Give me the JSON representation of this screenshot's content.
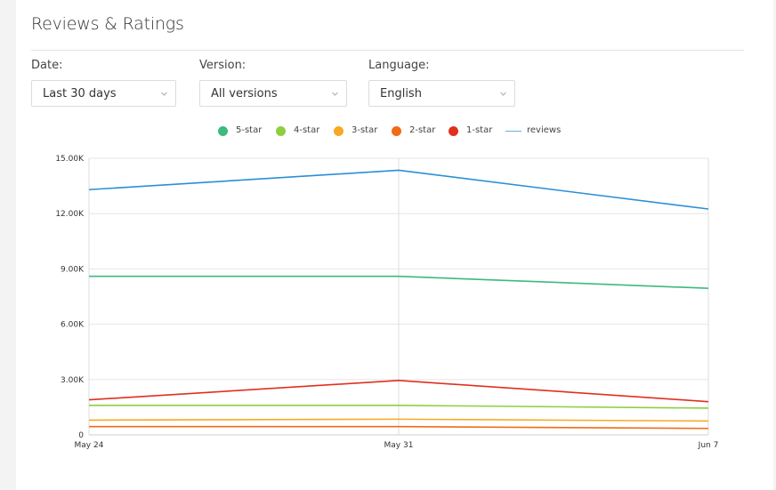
{
  "header": {
    "title": "Reviews & Ratings"
  },
  "filters": [
    {
      "label": "Date:",
      "value": "Last 30 days"
    },
    {
      "label": "Version:",
      "value": "All versions"
    },
    {
      "label": "Language:",
      "value": "English"
    }
  ],
  "legend": [
    {
      "name": "5-star",
      "color": "#3cba7f",
      "marker": "dot"
    },
    {
      "name": "4-star",
      "color": "#8ccf3f",
      "marker": "dot"
    },
    {
      "name": "3-star",
      "color": "#f9a823",
      "marker": "dot"
    },
    {
      "name": "2-star",
      "color": "#f26b17",
      "marker": "dot"
    },
    {
      "name": "1-star",
      "color": "#e0301e",
      "marker": "dot"
    },
    {
      "name": "reviews",
      "color": "#59b5e0",
      "marker": "line"
    }
  ],
  "chart_data": {
    "type": "line",
    "categories": [
      "May 24",
      "May 31",
      "Jun 7"
    ],
    "ylim": [
      0,
      15000
    ],
    "yticks": [
      0,
      3000,
      6000,
      9000,
      12000,
      15000
    ],
    "ytick_labels": [
      "0",
      "3.00K",
      "6.00K",
      "9.00K",
      "12.00K",
      "15.00K"
    ],
    "grid": true,
    "legend_position": "top-center",
    "series": [
      {
        "name": "reviews",
        "color": "#2a8fd6",
        "values": [
          13300,
          14350,
          12250
        ]
      },
      {
        "name": "5-star",
        "color": "#3cba7f",
        "values": [
          8600,
          8600,
          7950
        ]
      },
      {
        "name": "1-star",
        "color": "#e0301e",
        "values": [
          1900,
          2950,
          1800
        ]
      },
      {
        "name": "4-star",
        "color": "#8ccf3f",
        "values": [
          1600,
          1600,
          1450
        ]
      },
      {
        "name": "3-star",
        "color": "#f9a823",
        "values": [
          800,
          850,
          750
        ]
      },
      {
        "name": "2-star",
        "color": "#f26b17",
        "values": [
          450,
          450,
          350
        ]
      }
    ]
  }
}
